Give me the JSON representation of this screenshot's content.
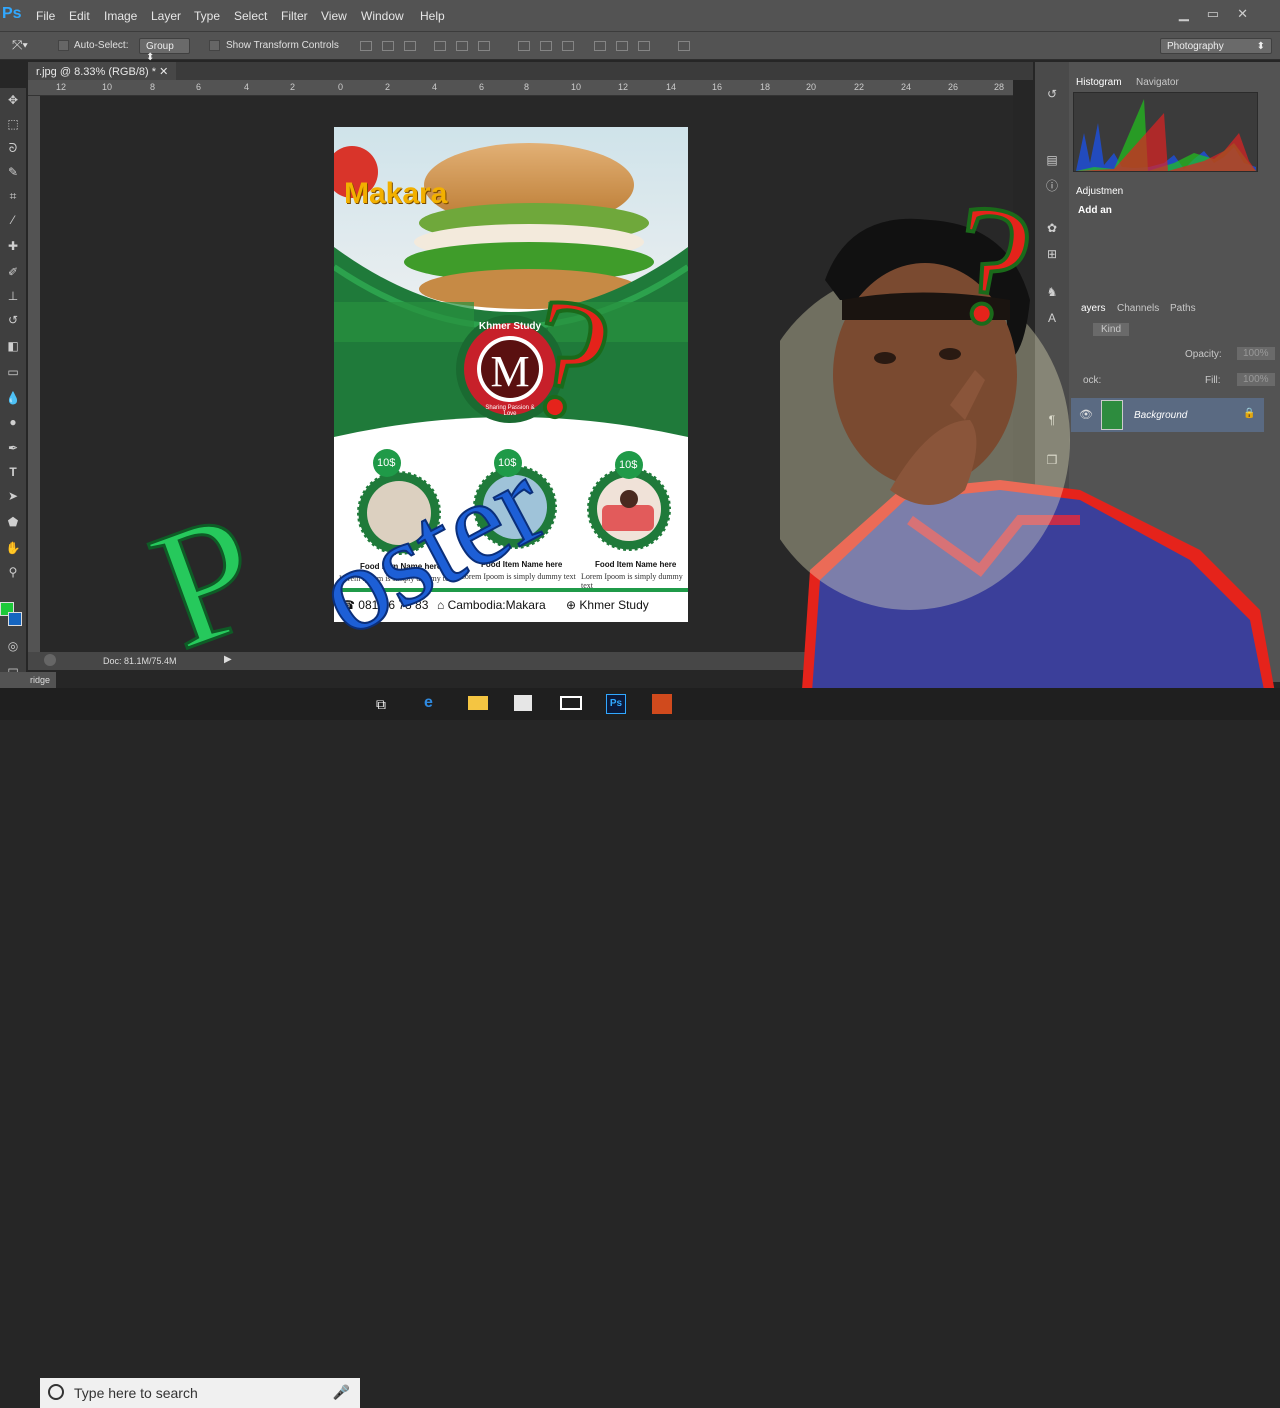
{
  "menubar": {
    "logo": "Ps",
    "items": [
      "File",
      "Edit",
      "Image",
      "Layer",
      "Type",
      "Select",
      "Filter",
      "View",
      "Window",
      "Help"
    ]
  },
  "options": {
    "auto_select_label": "Auto-Select:",
    "auto_select_value": "Group",
    "transform_label": "Show Transform Controls",
    "workspace": "Photography"
  },
  "document": {
    "tab_title": "r.jpg @ 8.33% (RGB/8) *",
    "status": "Doc: 81.1M/75.4M"
  },
  "ruler": {
    "ticks": [
      "12",
      "10",
      "8",
      "6",
      "4",
      "2",
      "0",
      "2",
      "4",
      "6",
      "8",
      "10",
      "12",
      "14",
      "16",
      "18",
      "20",
      "22",
      "24",
      "26",
      "28"
    ]
  },
  "panels": {
    "histogram_tab": "Histogram",
    "navigator_tab": "Navigator",
    "adjustments_tab": "Adjustmen",
    "add_label": "Add an",
    "layers_tab": "ayers",
    "channels_tab": "Channels",
    "paths_tab": "Paths",
    "kind": "Kind",
    "opacity_label": "Opacity:",
    "opacity_value": "100%",
    "lock_label": "ock:",
    "fill_label": "Fill:",
    "fill_value": "100%",
    "layer_name": "Background"
  },
  "bridge_label": "ridge",
  "taskbar": {
    "search_placeholder": "Type here to search"
  },
  "poster": {
    "brand": "Makara",
    "ring_text": "Khmer Study",
    "ring_sub": "Sharing Passion & Love",
    "monogram": "M",
    "prices": [
      "10$",
      "10$",
      "10$"
    ],
    "item_title": "Food Item Name here",
    "item_desc": "Lorem Ipoom is simply dummy text",
    "phone": "081 96 78 83",
    "location": "Cambodia:Makara",
    "website": "Khmer Study"
  },
  "overlay": {
    "word": "Poster",
    "mark": "?"
  },
  "colors": {
    "poster_green": "#1f7a3a",
    "accent_red": "#e5231b",
    "fg_swatch": "#1ec93a",
    "bg_swatch": "#1565c0"
  }
}
